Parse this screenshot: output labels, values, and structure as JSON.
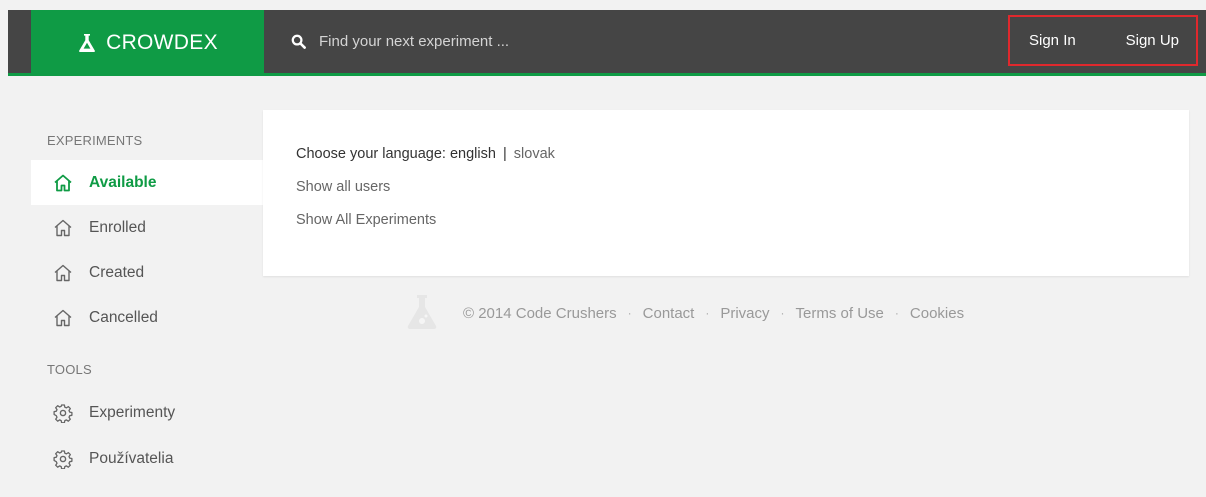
{
  "header": {
    "brand": "CROWDEX",
    "search_placeholder": "Find your next experiment ...",
    "sign_in": "Sign In",
    "sign_up": "Sign Up"
  },
  "sidebar": {
    "experiments_title": "EXPERIMENTS",
    "experiments": [
      {
        "label": "Available",
        "icon": "home-icon",
        "active": true
      },
      {
        "label": "Enrolled",
        "icon": "home-icon"
      },
      {
        "label": "Created",
        "icon": "home-icon"
      },
      {
        "label": "Cancelled",
        "icon": "home-icon"
      }
    ],
    "tools_title": "TOOLS",
    "tools": [
      {
        "label": "Experimenty",
        "icon": "gear-icon"
      },
      {
        "label": "Používatelia",
        "icon": "gear-icon"
      }
    ]
  },
  "main": {
    "language_prefix": "Choose your language:",
    "language_current": "english",
    "language_separator": "|",
    "language_other": "slovak",
    "show_users": "Show all users",
    "show_experiments": "Show All Experiments"
  },
  "footer": {
    "copyright": "© 2014 Code Crushers",
    "links": [
      "Contact",
      "Privacy",
      "Terms of Use",
      "Cookies"
    ],
    "separator": "·"
  },
  "colors": {
    "brand_green": "#0f9b45",
    "topbar": "#454545",
    "highlight_border": "#e0282d"
  }
}
